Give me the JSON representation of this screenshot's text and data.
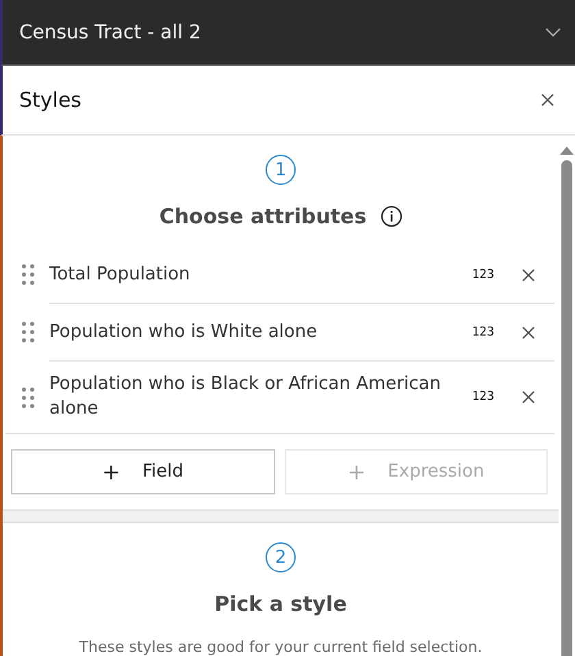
{
  "layer_header": {
    "title": "Census Tract - all 2",
    "expanded": false
  },
  "panel": {
    "title": "Styles"
  },
  "steps": [
    {
      "number": "1",
      "title": "Choose attributes",
      "info": true,
      "attributes": [
        {
          "name": "Total Population",
          "type_label": "123"
        },
        {
          "name": "Population who is White alone",
          "type_label": "123"
        },
        {
          "name": "Population who is Black or African American alone",
          "type_label": "123"
        }
      ],
      "buttons": [
        {
          "symbol": "+",
          "label": "Field",
          "disabled": false
        },
        {
          "symbol": "+",
          "label": "Expression",
          "disabled": true
        }
      ]
    },
    {
      "number": "2",
      "title": "Pick a style",
      "info": false,
      "description": "These styles are good for your current field selection."
    }
  ]
}
